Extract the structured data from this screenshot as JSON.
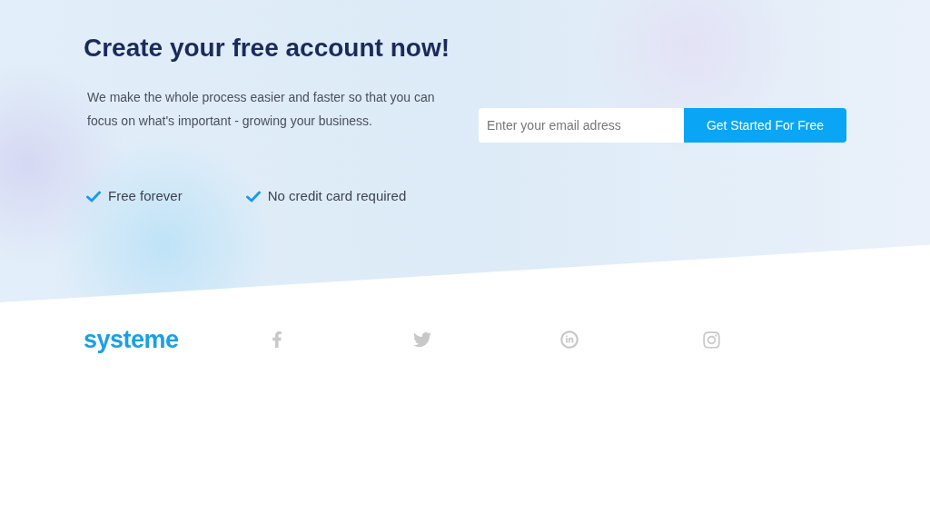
{
  "hero": {
    "title": "Create your free account now!",
    "description": "We make the whole process easier and faster so that you can focus on what's important - growing your business.",
    "features": [
      {
        "label": "Free forever"
      },
      {
        "label": "No credit card required"
      }
    ],
    "signup": {
      "placeholder": "Enter your email adress",
      "button": "Get Started For Free"
    }
  },
  "footer": {
    "logo": "systeme"
  }
}
